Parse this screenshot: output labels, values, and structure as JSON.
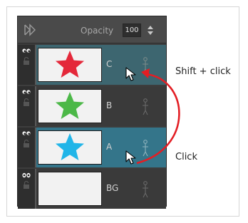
{
  "toolbar": {
    "opacity_label": "Opacity",
    "opacity_value": "100",
    "play_icon": "play-forward-icon",
    "stepper_icon": "up-down-stepper-icon"
  },
  "layers": [
    {
      "name": "C",
      "thumbnail": "red-star",
      "star_color": "#e4283a",
      "state": "selected"
    },
    {
      "name": "B",
      "thumbnail": "green-star",
      "star_color": "#4cb848",
      "state": "normal"
    },
    {
      "name": "A",
      "thumbnail": "blue-star",
      "star_color": "#21b5e8",
      "state": "highlighted"
    },
    {
      "name": "BG",
      "thumbnail": "empty",
      "star_color": "",
      "state": "normal"
    }
  ],
  "annotations": {
    "shift_click": "Shift + click",
    "click": "Click"
  },
  "colors": {
    "arrow": "#e31e24",
    "selected_row": "#3d6670",
    "highlighted_row": "#34758a"
  }
}
